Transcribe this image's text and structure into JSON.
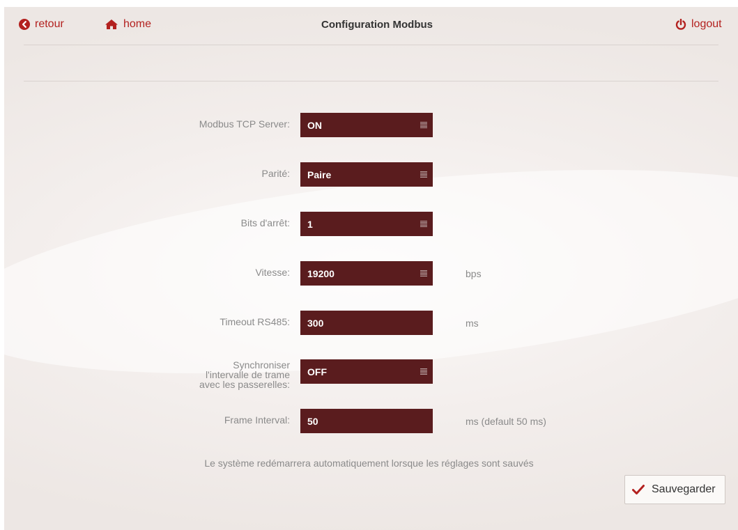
{
  "header": {
    "back_label": "retour",
    "home_label": "home",
    "title": "Configuration Modbus",
    "logout_label": "logout"
  },
  "icons": {
    "back": "chevron-left-circle-icon",
    "home": "home-icon",
    "logout": "power-icon",
    "save": "checkmark-icon",
    "dropdown": "list-icon"
  },
  "colors": {
    "accent": "#b3211f",
    "field_bg": "#5a1c1e",
    "label": "#8a8a8a"
  },
  "form": {
    "modbus_tcp": {
      "label": "Modbus TCP Server:",
      "value": "ON"
    },
    "parity": {
      "label": "Parité:",
      "value": "Paire"
    },
    "stop_bits": {
      "label": "Bits d'arrêt:",
      "value": "1"
    },
    "speed": {
      "label": "Vitesse:",
      "value": "19200",
      "unit": "bps"
    },
    "timeout": {
      "label": "Timeout RS485:",
      "value": "300",
      "unit": "ms"
    },
    "sync": {
      "label_line1": "Synchroniser",
      "label_line2": "l'intervalle de trame",
      "label_line3": "avec les passerelles:",
      "value": "OFF"
    },
    "frame_interval": {
      "label": "Frame Interval:",
      "value": "50",
      "unit": "ms (default 50 ms)"
    }
  },
  "footer": {
    "note": "Le système redémarrera automatiquement lorsque les réglages sont sauvés",
    "save_label": "Sauvegarder"
  }
}
